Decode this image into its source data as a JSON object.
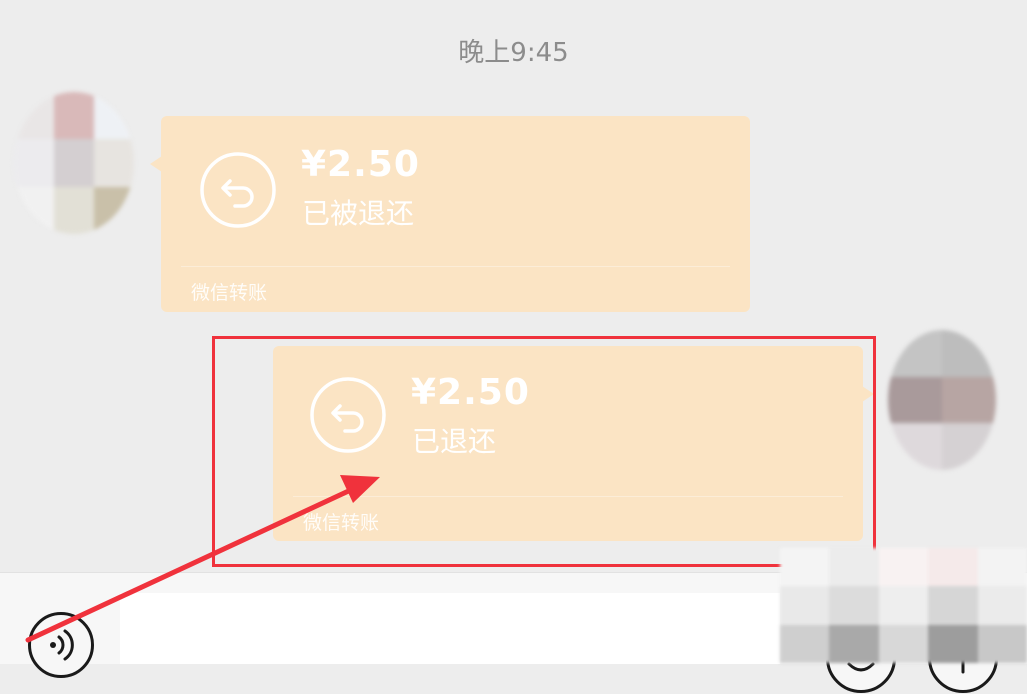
{
  "chat": {
    "timestamp": "晚上9:45",
    "messages": [
      {
        "side": "left",
        "amount": "¥2.50",
        "status": "已被退还",
        "label": "微信转账",
        "icon": "return-arrow-icon"
      },
      {
        "side": "right",
        "amount": "¥2.50",
        "status": "已退还",
        "label": "微信转账",
        "icon": "return-arrow-icon"
      }
    ]
  },
  "bottom_bar": {
    "voice_icon": "voice-icon",
    "emoji_icon": "emoji-icon",
    "plus_icon": "plus-icon"
  },
  "annotation": {
    "highlight_color": "#f0323c",
    "arrow_color": "#f0323c"
  },
  "colors": {
    "card_background": "#fbe4c4",
    "chat_background": "#ededed"
  }
}
